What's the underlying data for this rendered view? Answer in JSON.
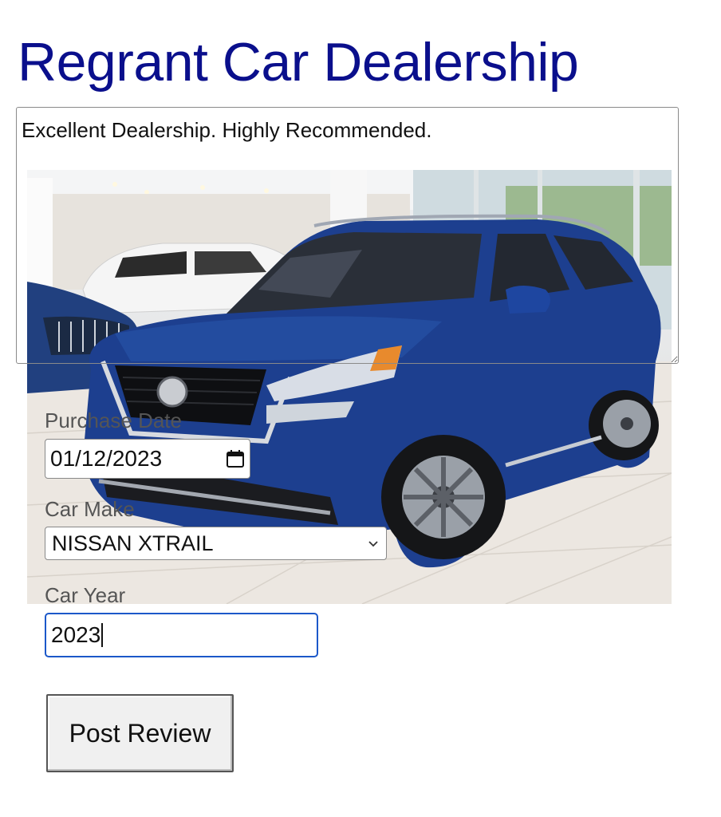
{
  "page": {
    "title": "Regrant Car Dealership",
    "title_color": "#0a0f8c"
  },
  "review": {
    "text": "Excellent Dealership. Highly Recommended."
  },
  "image": {
    "icon": "car-photo",
    "car_color": "#1d3f8f"
  },
  "form": {
    "purchase_date_label": "Purchase Date",
    "purchase_date_value": "01/12/2023",
    "car_make_label": "Car Make",
    "car_make_value": "NISSAN XTRAIL",
    "car_year_label": "Car Year",
    "car_year_value": "2023",
    "submit_label": "Post Review",
    "focus_color": "#1c58c9"
  }
}
